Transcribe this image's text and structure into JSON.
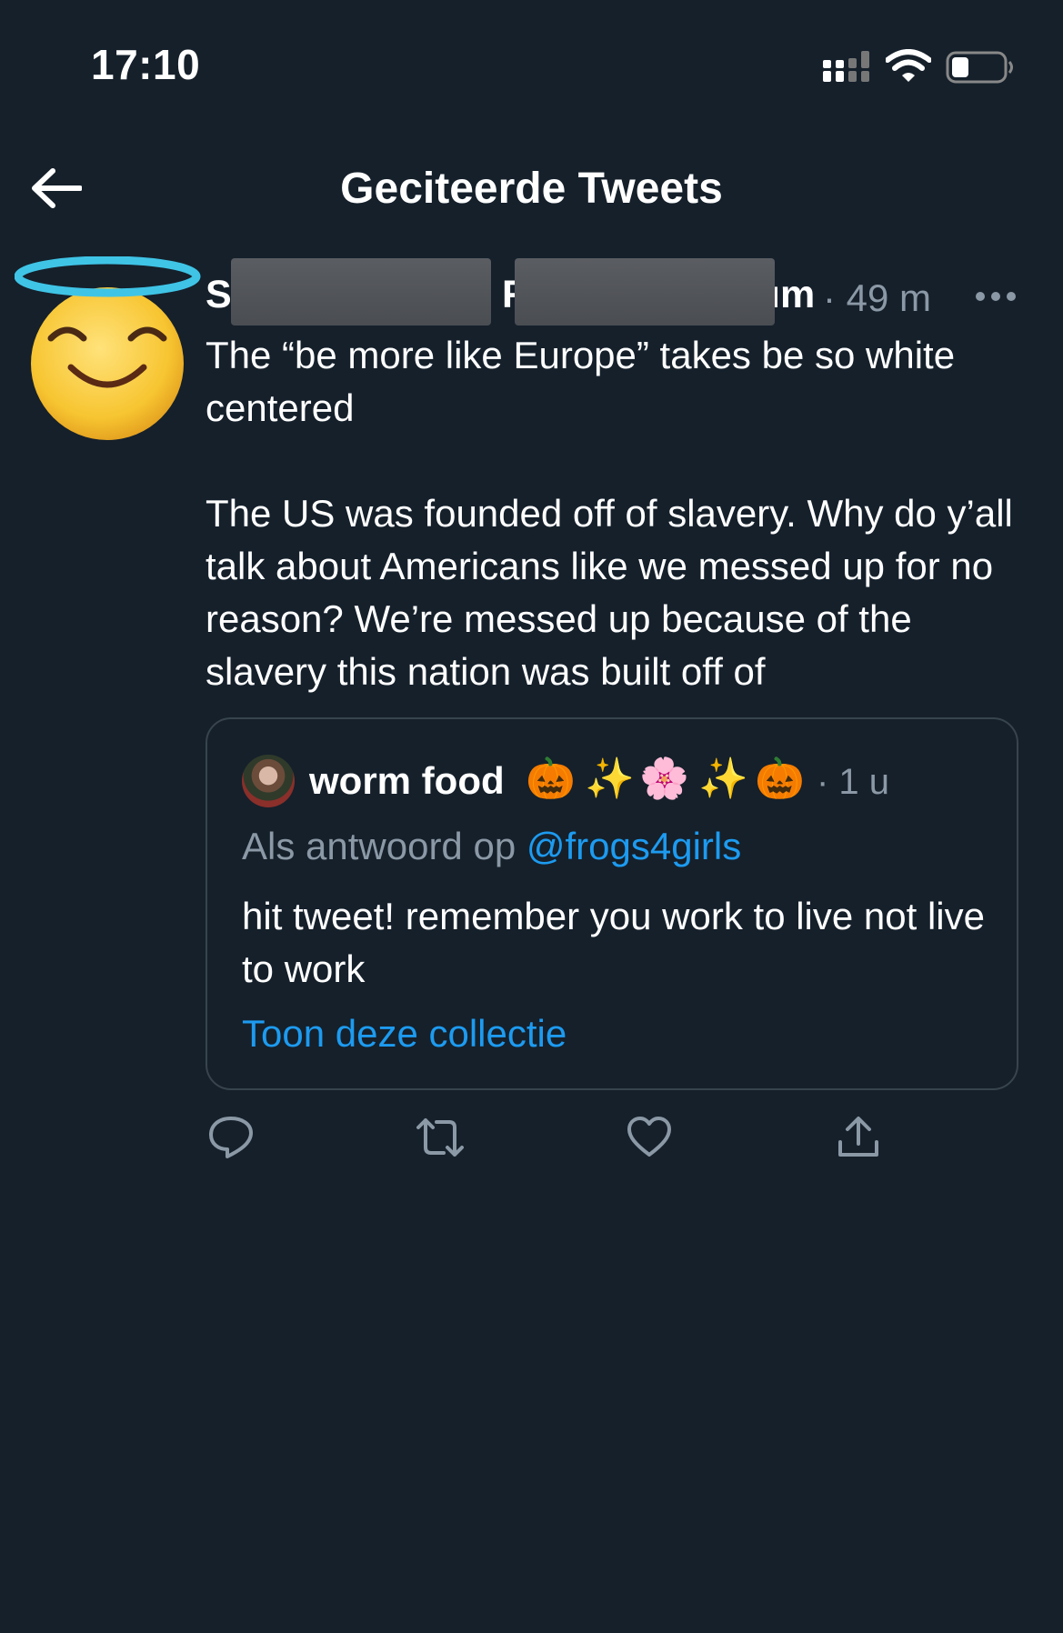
{
  "status_bar": {
    "time": "17:10"
  },
  "header": {
    "title": "Geciteerde Tweets"
  },
  "tweet": {
    "name_first": "S",
    "name_mid": "F",
    "name_end": "ım",
    "meta": "· 49 m",
    "paragraphs": [
      "The “be more like Europe” takes be so white centered",
      "The US was founded off of slavery. Why do y’all talk about Americans like we messed up for no reason? We’re messed up because of the slavery this nation was built off of"
    ]
  },
  "quote": {
    "name": "worm food",
    "emojis": [
      "🎃",
      "✨",
      "🌸",
      "✨",
      "🎃"
    ],
    "time": "· 1 u",
    "reply_prefix": "Als antwoord op ",
    "reply_handle": "@frogs4girls",
    "text": "hit tweet! remember you work to live not live to work",
    "link": "Toon deze collectie"
  },
  "icons": {
    "back": "arrow-left-icon",
    "more": "more-icon",
    "reply": "reply-icon",
    "retweet": "retweet-icon",
    "like": "heart-icon",
    "share": "share-icon"
  },
  "colors": {
    "background": "#15202b",
    "muted": "#8b98a5",
    "accent": "#1d9bf0",
    "border": "#38444d"
  }
}
